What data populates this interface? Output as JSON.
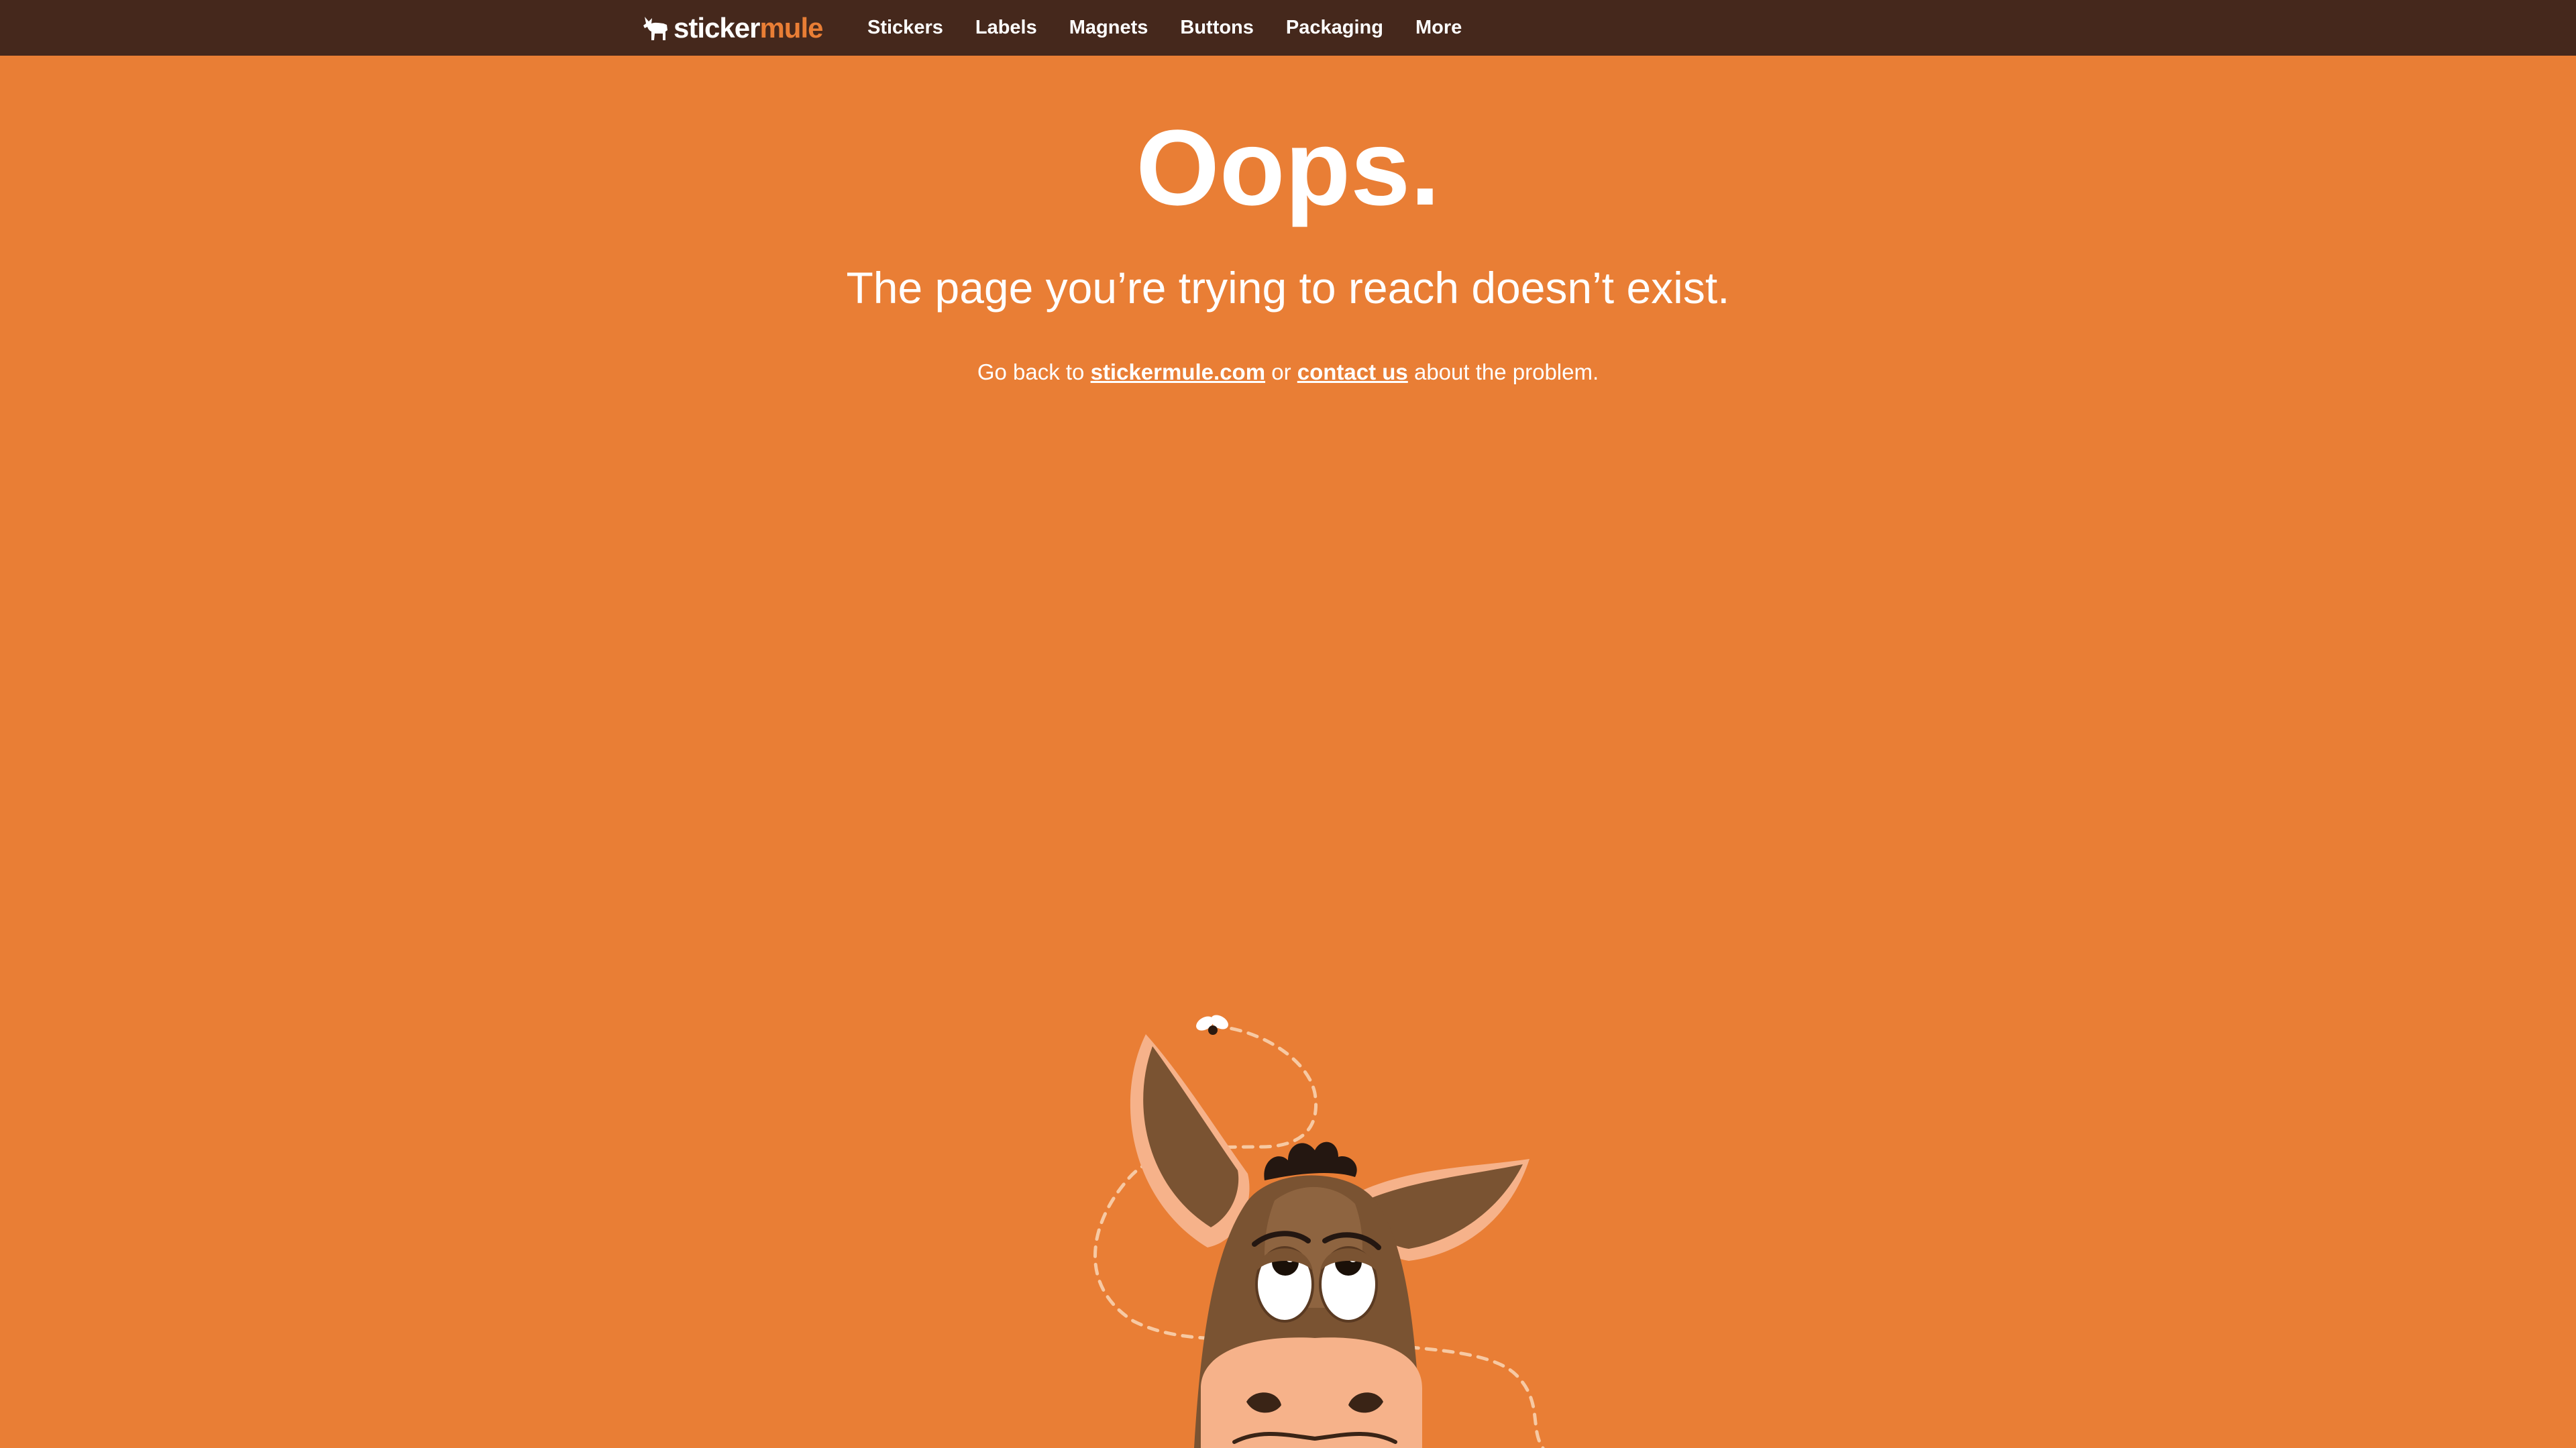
{
  "brand": {
    "name_part1": "sticker",
    "name_part2": "mule",
    "logo_icon": "mule-silhouette-icon"
  },
  "nav": {
    "items": [
      {
        "label": "Stickers"
      },
      {
        "label": "Labels"
      },
      {
        "label": "Magnets"
      },
      {
        "label": "Buttons"
      },
      {
        "label": "Packaging"
      },
      {
        "label": "More"
      }
    ]
  },
  "error": {
    "headline": "Oops.",
    "subhead": "The page you’re trying to reach doesn’t exist.",
    "help_prefix": "Go back to ",
    "home_link": "stickermule.com",
    "help_middle": " or ",
    "contact_link": "contact us",
    "help_suffix": " about the problem."
  },
  "illustration": {
    "name": "mule-with-fly-illustration"
  },
  "colors": {
    "background": "#E97E35",
    "topbar": "#45281C",
    "text": "#FFFFFF"
  }
}
